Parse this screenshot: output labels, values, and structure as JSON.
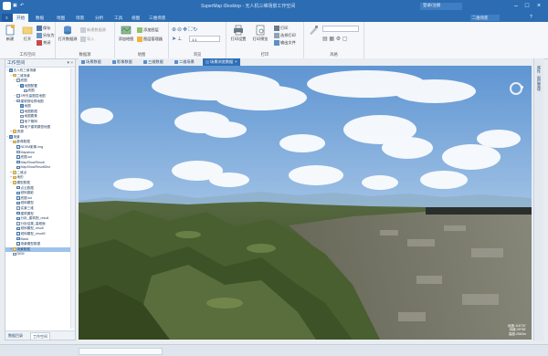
{
  "window": {
    "title": "SuperMap iDesktop - 无人机三维场景工作空间",
    "account": "登录/注册"
  },
  "ribbon_tabs": [
    {
      "label": "开始",
      "active": true
    },
    {
      "label": "数据",
      "active": false
    },
    {
      "label": "地图",
      "active": false
    },
    {
      "label": "场景",
      "active": false
    },
    {
      "label": "分析",
      "active": false
    },
    {
      "label": "工具",
      "active": false
    },
    {
      "label": "视图",
      "active": false
    },
    {
      "label": "三维场景",
      "active": false
    }
  ],
  "ribbon_right_label": "二维场景",
  "ribbon": {
    "workspace": {
      "label": "工作空间",
      "new_label": "新建",
      "open_label": "打开",
      "save_label": "保存",
      "save_as_label": "另存为",
      "close_label": "关闭"
    },
    "datasource": {
      "label": "数据源",
      "open_ds_label": "打开数据源",
      "new_ds_label": "新建数据源",
      "import_label": "导入",
      "export_label": "导出"
    },
    "map": {
      "label": "地图",
      "add_map_label": "添加地图",
      "add_layer_label": "添加图层",
      "layer_manager_label": "图层管理器"
    },
    "browse": {
      "label": "浏览",
      "scale_value": "1:1"
    },
    "print": {
      "label": "打印",
      "print_setup_label": "打印设置",
      "print_preview_label": "打印预览",
      "print_label": "打印",
      "print_area_label": "选择打印",
      "output_label": "输出文件"
    },
    "style": {
      "label": "风格",
      "combo_value": ""
    }
  },
  "panel": {
    "title": "工作空间",
    "pin_label": "▾ ×"
  },
  "tree": [
    {
      "label": "无人机三维场景",
      "level": 0,
      "icon": "map",
      "toggle": "−"
    },
    {
      "label": "二维场景",
      "level": 1,
      "icon": "folder",
      "toggle": "−"
    },
    {
      "label": "底图",
      "level": 2,
      "icon": "layer",
      "toggle": "−"
    },
    {
      "label": "地图配置",
      "level": 3,
      "icon": "map",
      "toggle": "−"
    },
    {
      "label": "底图",
      "level": 4,
      "icon": "layer",
      "toggle": ""
    },
    {
      "label": "3号矢量图层地图",
      "level": 2,
      "icon": "layer",
      "toggle": "−"
    },
    {
      "label": "建筑物轮廓地图",
      "level": 2,
      "icon": "layer",
      "toggle": "−"
    },
    {
      "label": "地图",
      "level": 3,
      "icon": "map",
      "toggle": ""
    },
    {
      "label": "地图数据",
      "level": 3,
      "icon": "layer",
      "toggle": ""
    },
    {
      "label": "地图要素",
      "level": 3,
      "icon": "layer",
      "toggle": ""
    },
    {
      "label": "地下管网",
      "level": 3,
      "icon": "layer",
      "toggle": ""
    },
    {
      "label": "地下建筑模型地图",
      "level": 3,
      "icon": "layer",
      "toggle": ""
    },
    {
      "label": "资源",
      "level": 1,
      "icon": "folder",
      "toggle": "+"
    },
    {
      "label": "场景",
      "level": 0,
      "icon": "map",
      "toggle": "−"
    },
    {
      "label": "影像数据",
      "level": 1,
      "icon": "folder",
      "toggle": "−"
    },
    {
      "label": "NDSM影像.img",
      "level": 2,
      "icon": "chk",
      "toggle": ""
    },
    {
      "label": "Mapshow",
      "level": 2,
      "icon": "layer",
      "toggle": ""
    },
    {
      "label": "底图.sci",
      "level": 2,
      "icon": "chk",
      "toggle": ""
    },
    {
      "label": "MapShowResult",
      "level": 2,
      "icon": "chk",
      "toggle": ""
    },
    {
      "label": "MapShowResultDist",
      "level": 2,
      "icon": "chk",
      "toggle": ""
    },
    {
      "label": "二维点",
      "level": 1,
      "icon": "folder",
      "toggle": "+"
    },
    {
      "label": "地形",
      "level": 1,
      "icon": "folder",
      "toggle": "+"
    },
    {
      "label": "模型数据",
      "level": 1,
      "icon": "folder",
      "toggle": "−"
    },
    {
      "label": "点云数据",
      "level": 2,
      "icon": "chk",
      "toggle": ""
    },
    {
      "label": "倾斜摄影",
      "level": 2,
      "icon": "chk",
      "toggle": ""
    },
    {
      "label": "底图.sci",
      "level": 2,
      "icon": "chk",
      "toggle": ""
    },
    {
      "label": "倾斜模型",
      "level": 2,
      "icon": "chk",
      "toggle": ""
    },
    {
      "label": "实景三维",
      "level": 2,
      "icon": "layer",
      "toggle": ""
    },
    {
      "label": "建筑模型",
      "level": 2,
      "icon": "chk",
      "toggle": ""
    },
    {
      "label": "分析_建筑物_result",
      "level": 2,
      "icon": "chk",
      "toggle": ""
    },
    {
      "label": "分析结果_高程面",
      "level": 2,
      "icon": "layer",
      "toggle": ""
    },
    {
      "label": "倾斜模型_result",
      "level": 2,
      "icon": "chk",
      "toggle": ""
    },
    {
      "label": "倾斜模型_result2",
      "level": 2,
      "icon": "chk",
      "toggle": ""
    },
    {
      "label": "Basic",
      "level": 2,
      "icon": "chk",
      "toggle": ""
    },
    {
      "label": "场景模型数据",
      "level": 2,
      "icon": "chk",
      "toggle": ""
    },
    {
      "label": "场景数据",
      "level": 1,
      "icon": "folder",
      "toggle": "+",
      "selected": true
    },
    {
      "label": "DEM",
      "level": 1,
      "icon": "layer",
      "toggle": ""
    }
  ],
  "panel_bottom_tabs": [
    {
      "label": "数据目录",
      "active": false
    },
    {
      "label": "工作空间",
      "active": true
    }
  ],
  "doc_tabs": [
    {
      "label": "场景数据",
      "active": false
    },
    {
      "label": "影像数据",
      "active": false
    },
    {
      "label": "三维数据",
      "active": false
    },
    {
      "label": "二维场景",
      "active": false
    },
    {
      "label": "场景浏览数据",
      "active": true
    }
  ],
  "right_strip_label": "属性 · 图层管理",
  "scene": {
    "coord_lines": [
      "经度:116°20'",
      "纬度:39°58'",
      "高度:2563m"
    ]
  },
  "colors": {
    "accent": "#2b6cb3",
    "active_tab": "#2e6fb8",
    "selected_row": "#9ec3ea"
  }
}
